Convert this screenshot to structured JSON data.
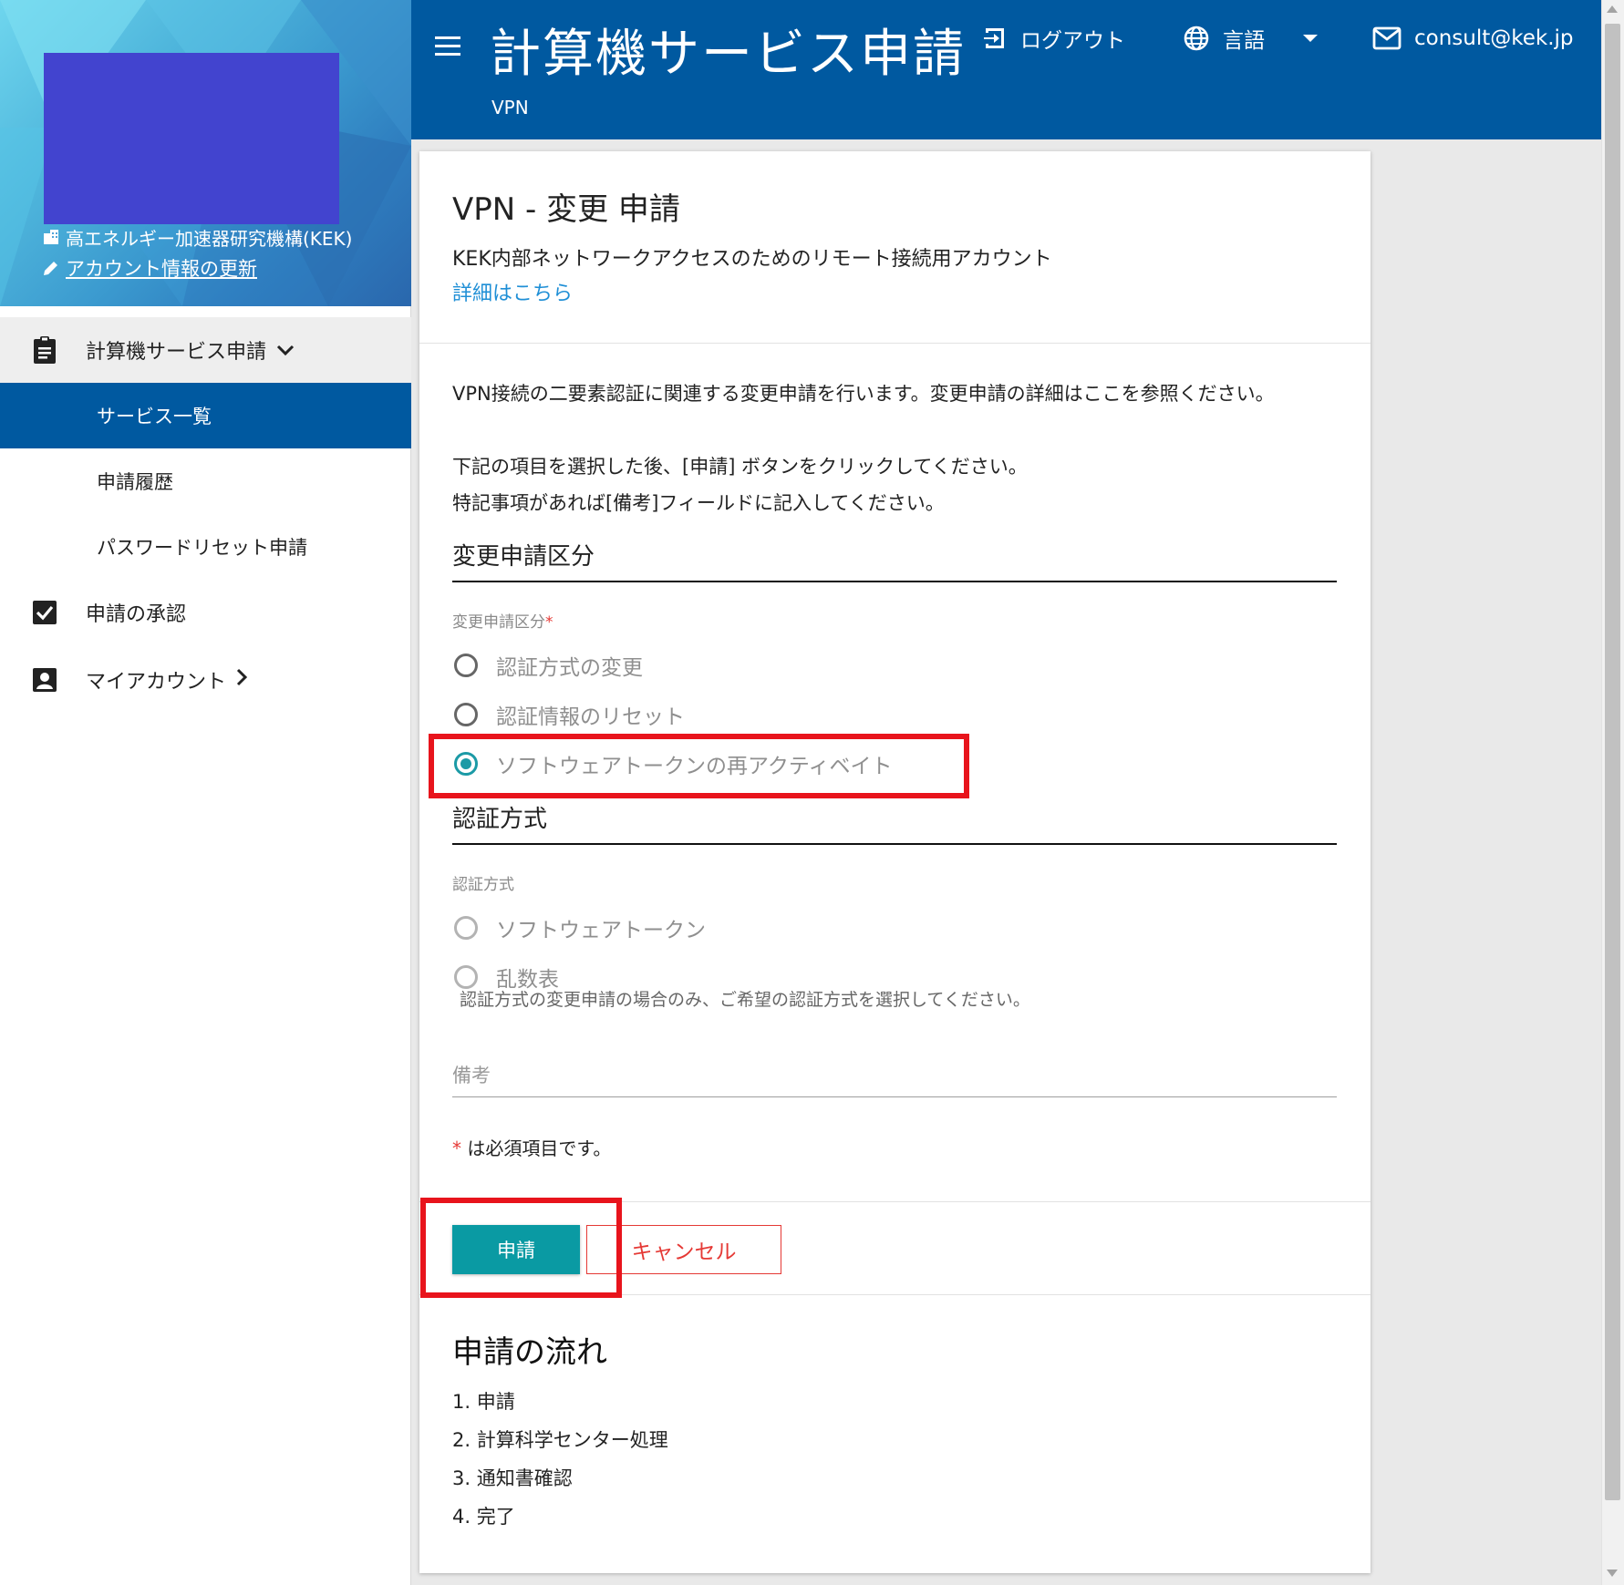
{
  "app": {
    "title": "計算機サービス申請",
    "subtitle": "VPN",
    "logout_label": "ログアウト",
    "language_label": "言語",
    "email": "consult@kek.jp"
  },
  "sidebar": {
    "org_name": "高エネルギー加速器研究機構(KEK)",
    "account_update": "アカウント情報の更新",
    "sections": {
      "requests": "計算機サービス申請",
      "service_list": "サービス一覧",
      "history": "申請履歴",
      "password_reset": "パスワードリセット申請",
      "approval": "申請の承認",
      "my_account": "マイアカウント"
    }
  },
  "card": {
    "title": "VPN - 変更 申請",
    "description": "KEK内部ネットワークアクセスのためのリモート接続用アカウント",
    "details_link": "詳細はこちら",
    "intro": [
      "VPN接続の二要素認証に関連する変更申請を行います。変更申請の詳細はここを参照ください。",
      "下記の項目を選択した後、[申請] ボタンをクリックしてください。",
      "特記事項があれば[備考]フィールドに記入してください。"
    ],
    "change_section": {
      "heading": "変更申請区分",
      "label": "変更申請区分",
      "required_mark": "*",
      "options": [
        "認証方式の変更",
        "認証情報のリセット",
        "ソフトウェアトークンの再アクティベイト"
      ],
      "selected_index": 2
    },
    "method_section": {
      "heading": "認証方式",
      "label": "認証方式",
      "options": [
        "ソフトウェアトークン",
        "乱数表"
      ],
      "hint": "認証方式の変更申請の場合のみ、ご希望の認証方式を選択してください。"
    },
    "remarks_placeholder": "備考",
    "required_note_mark": "*",
    "required_note": " は必須項目です。",
    "submit_label": "申請",
    "cancel_label": "キャンセル",
    "flow": {
      "title": "申請の流れ",
      "steps": [
        "1. 申請",
        "2. 計算科学センター処理",
        "3. 通知書確認",
        "4. 完了"
      ]
    }
  },
  "colors": {
    "primary": "#0059a0",
    "accent": "#0a9aa3",
    "link": "#1f8fd6",
    "danger": "#e53935",
    "highlight": "#e8141c",
    "redaction": "#4244cf"
  }
}
